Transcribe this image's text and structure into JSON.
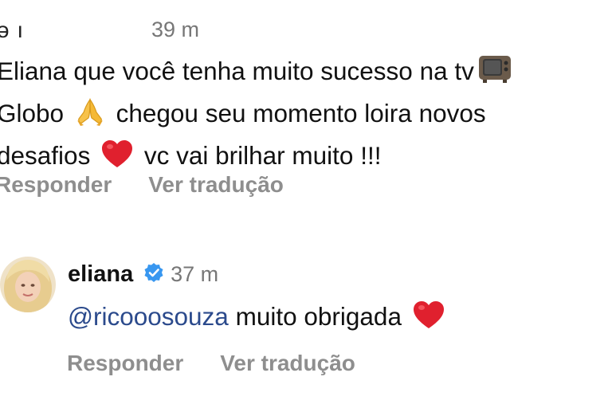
{
  "first_comment": {
    "username_fragment": "ə ı",
    "time": "39 m",
    "text_line1": "Eliana que você tenha muito sucesso na tv",
    "text_line2_a": "Globo",
    "text_line2_b": "chegou seu momento loira novos",
    "text_line3_a": "desafios",
    "text_line3_b": "vc vai brilhar muito !!!",
    "reply_label": "Responder",
    "translate_label": "Ver tradução",
    "emojis": [
      "television-icon",
      "folded-hands-icon",
      "red-heart-icon"
    ]
  },
  "reply_comment": {
    "username": "eliana",
    "verified": true,
    "time": "37 m",
    "mention": "@ricooosouza",
    "text": "muito obrigada",
    "reply_label": "Responder",
    "translate_label": "Ver tradução",
    "colors": {
      "mention": "#2b4a8c",
      "verified": "#3897f0",
      "secondary_text": "#8e8e8e"
    }
  }
}
